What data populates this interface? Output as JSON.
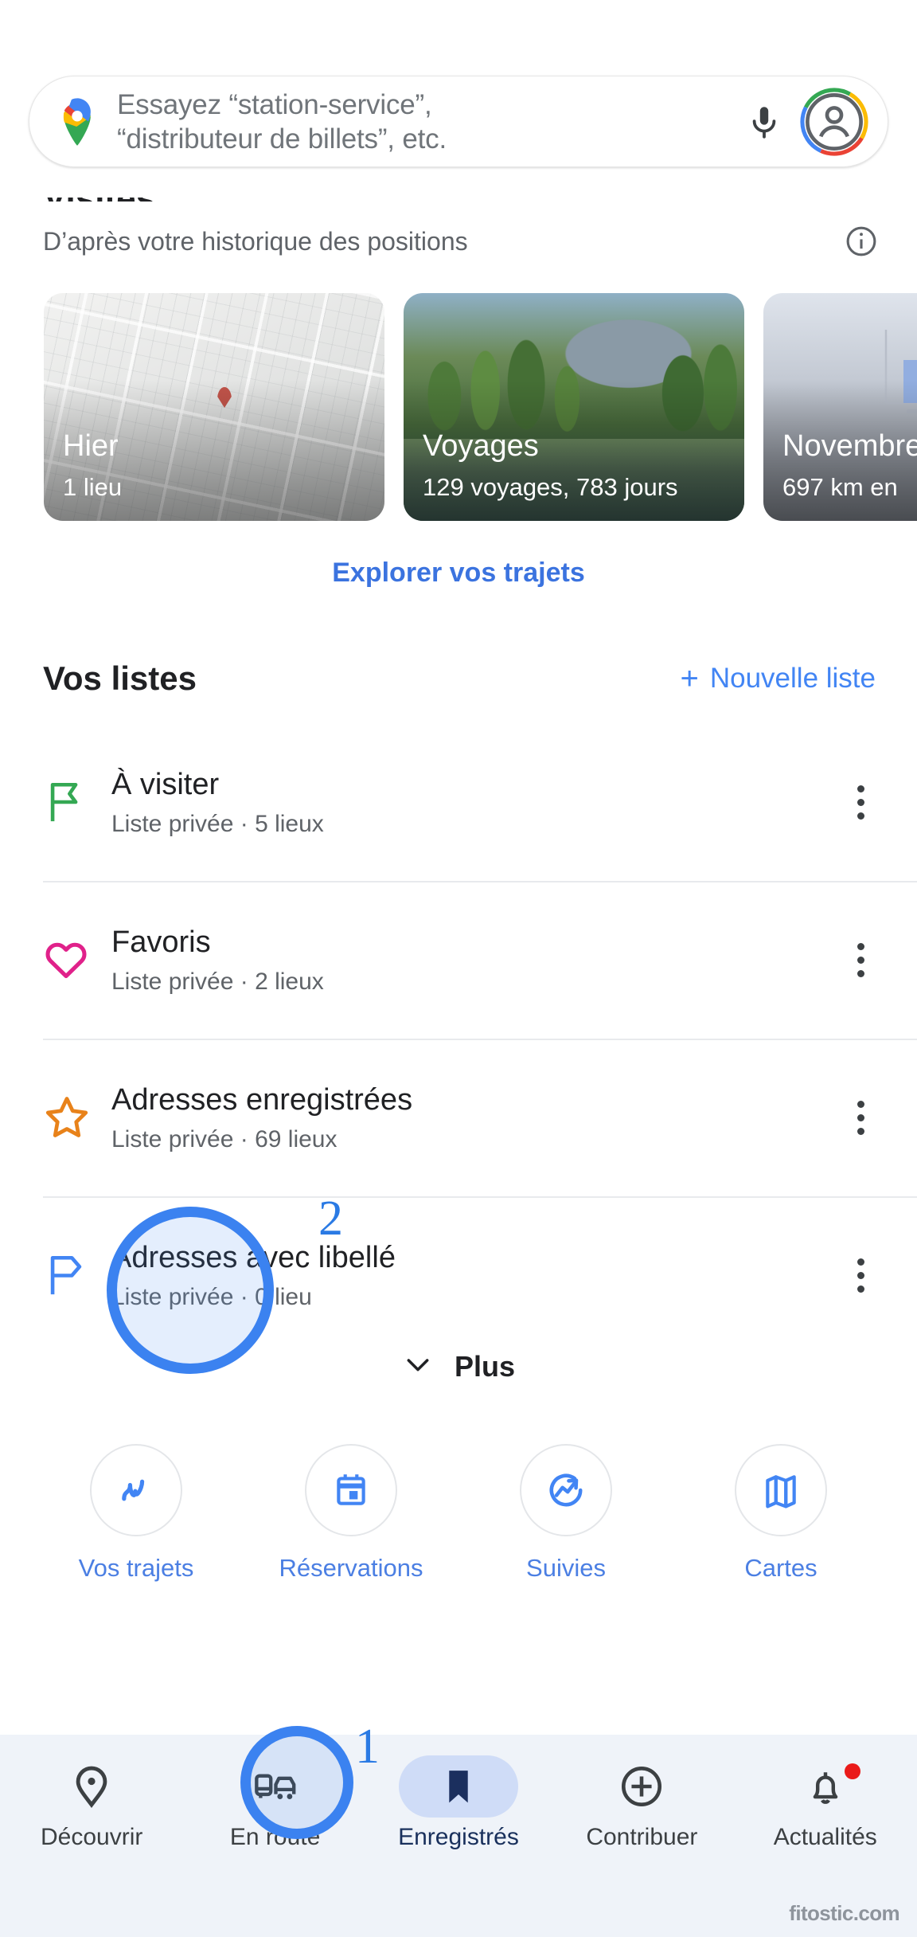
{
  "search": {
    "placeholder": "Essayez “station-service”,\n“distributeur de billets”, etc.",
    "mic_icon": "microphone-icon",
    "logo_icon": "google-maps-pin-icon",
    "avatar_icon": "account-avatar-icon"
  },
  "timeline": {
    "cut_heading": "Visites",
    "subtitle": "D’après votre historique des positions",
    "info_icon": "info-icon",
    "cards": [
      {
        "title": "Hier",
        "subtitle": "1 lieu",
        "thumb": "map-thumbnail"
      },
      {
        "title": "Voyages",
        "subtitle": "129 voyages, 783 jours",
        "thumb": "landscape-photo"
      },
      {
        "title": "Novembre",
        "subtitle": "697 km en",
        "thumb": "bar-chart-thumbnail"
      }
    ],
    "explore_link": "Explorer vos trajets"
  },
  "lists": {
    "title": "Vos listes",
    "new_list_label": "Nouvelle liste",
    "new_list_icon": "plus-icon",
    "items": [
      {
        "name": "À visiter",
        "meta": "Liste privée · 5 lieux",
        "icon": "green-flag-icon",
        "color": "#34a853"
      },
      {
        "name": "Favoris",
        "meta": "Liste privée · 2 lieux",
        "icon": "pink-heart-icon",
        "color": "#e0218a"
      },
      {
        "name": "Adresses enregistrées",
        "meta": "Liste privée · 69 lieux",
        "icon": "orange-star-icon",
        "color": "#e8821a"
      },
      {
        "name": "Adresses avec libellé",
        "meta": "Liste privée · 0 lieu",
        "icon": "blue-label-flag-icon",
        "color": "#4285f4"
      }
    ],
    "overflow_icon": "more-vertical-icon",
    "more_label": "Plus",
    "more_icon": "chevron-down-icon"
  },
  "quick_access": [
    {
      "label": "Vos trajets",
      "icon": "route-line-icon"
    },
    {
      "label": "Réservations",
      "icon": "calendar-icon"
    },
    {
      "label": "Suivies",
      "icon": "trending-circle-icon"
    },
    {
      "label": "Cartes",
      "icon": "folded-map-icon"
    }
  ],
  "bottom_nav": {
    "items": [
      {
        "label": "Découvrir",
        "icon": "map-pin-icon",
        "active": false,
        "badge": false
      },
      {
        "label": "En route",
        "icon": "commute-icon",
        "active": false,
        "badge": false
      },
      {
        "label": "Enregistrés",
        "icon": "bookmark-icon",
        "active": true,
        "badge": false
      },
      {
        "label": "Contribuer",
        "icon": "plus-circle-icon",
        "active": false,
        "badge": false
      },
      {
        "label": "Actualités",
        "icon": "bell-icon",
        "active": false,
        "badge": true
      }
    ]
  },
  "annotations": {
    "marker_1": "1",
    "marker_2": "2",
    "accent_color": "#3b82f0"
  },
  "watermark": "fitostic.com"
}
